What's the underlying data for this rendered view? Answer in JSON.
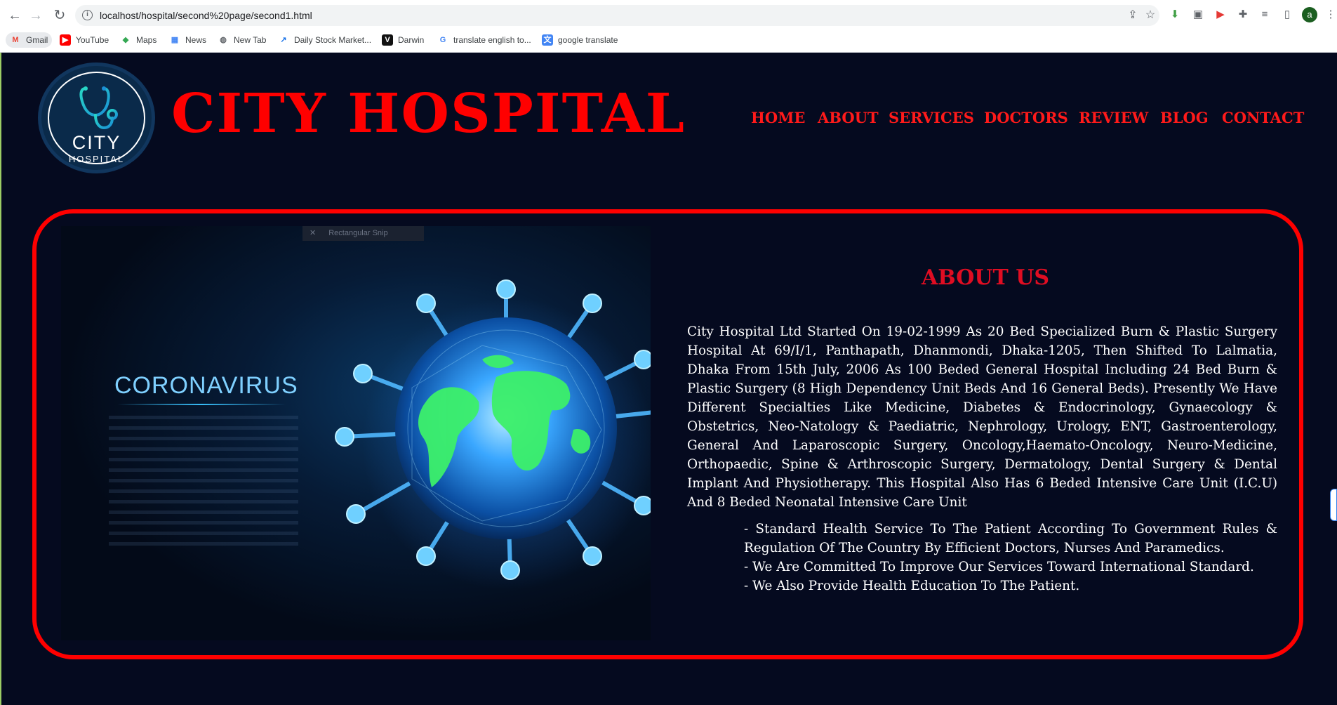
{
  "browser": {
    "url": "localhost/hospital/second%20page/second1.html",
    "avatar_letter": "a",
    "bookmarks": [
      {
        "label": "Gmail",
        "icon": "gmail-icon",
        "glyph": "M",
        "color": "#ea4335"
      },
      {
        "label": "YouTube",
        "icon": "youtube-icon",
        "glyph": "▶",
        "color": "#ff0000"
      },
      {
        "label": "Maps",
        "icon": "maps-pin-icon",
        "glyph": "◆",
        "color": "#34a853"
      },
      {
        "label": "News",
        "icon": "news-icon",
        "glyph": "▦",
        "color": "#4285f4"
      },
      {
        "label": "New Tab",
        "icon": "globe-icon",
        "glyph": "◍",
        "color": "#5f6368"
      },
      {
        "label": "Daily Stock Market...",
        "icon": "stock-icon",
        "glyph": "↗",
        "color": "#1a73e8"
      },
      {
        "label": "Darwin",
        "icon": "darwin-icon",
        "glyph": "V",
        "color": "#111111"
      },
      {
        "label": "translate english to...",
        "icon": "google-icon",
        "glyph": "G",
        "color": "#4285f4"
      },
      {
        "label": "google translate",
        "icon": "translate-icon",
        "glyph": "文",
        "color": "#4285f4"
      }
    ]
  },
  "site": {
    "logo_city": "CITY",
    "logo_hospital": "HOSPITAL",
    "title": "CITY HOSPITAL",
    "nav": [
      "HOME",
      "ABOUT",
      "SERVICES",
      "DOCTORS",
      "REVIEW",
      "BLOG",
      "CONTACT"
    ]
  },
  "image": {
    "snip_label": "Rectangular Snip",
    "headline": "CORONAVIRUS"
  },
  "about": {
    "title": "ABOUT US",
    "paragraph": "City Hospital Ltd Started On 19-02-1999 As 20 Bed Specialized Burn & Plastic Surgery Hospital At 69/I/1, Panthapath, Dhanmondi, Dhaka-1205, Then Shifted To Lalmatia, Dhaka From 15th July, 2006 As 100 Beded General Hospital Including 24 Bed Burn & Plastic Surgery (8 High Dependency Unit Beds And 16 General Beds). Presently We Have Different Specialties Like Medicine, Diabetes & Endocrinology, Gynaecology & Obstetrics, Neo-Natology & Paediatric, Nephrology, Urology, ENT, Gastroenterology, General And Laparoscopic Surgery, Oncology,Haemato-Oncology, Neuro-Medicine, Orthopaedic, Spine & Arthroscopic Surgery, Dermatology, Dental Surgery & Dental Implant And Physiotherapy. This Hospital Also Has 6 Beded Intensive Care Unit (I.C.U) And 8 Beded Neonatal Intensive Care Unit",
    "points": [
      "- Standard Health Service To The Patient According To Government Rules & Regulation Of The Country By Efficient Doctors, Nurses And Paramedics.",
      "- We Are Committed To Improve Our Services Toward International Standard.",
      "- We Also Provide Health Education To The Patient."
    ]
  },
  "colors": {
    "background": "#050a1f",
    "accent_red": "#ff0000",
    "text": "#ffffff"
  }
}
